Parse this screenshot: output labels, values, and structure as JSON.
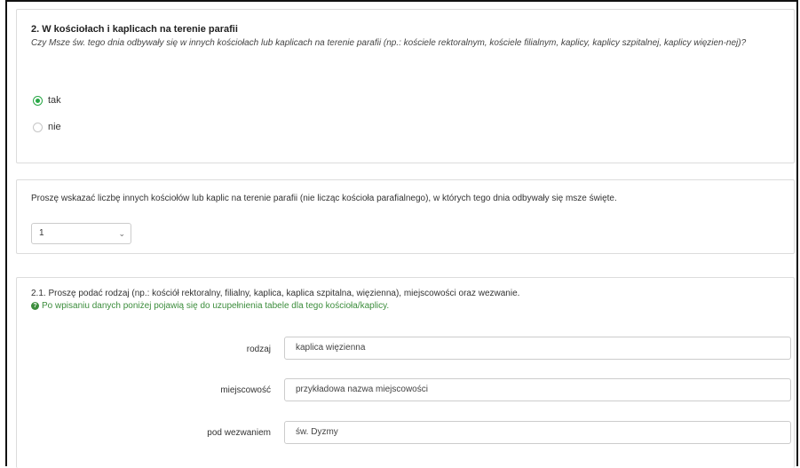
{
  "section1": {
    "title": "2. W kościołach i kaplicach na terenie parafii",
    "question": "Czy Msze św. tego dnia odbywały się w innych kościołach lub kaplicach na terenie parafii (np.: kościele rektoralnym, kościele filialnym, kaplicy, kaplicy szpitalnej, kaplicy więzien-nej)?",
    "options": [
      {
        "label": "tak",
        "checked": true
      },
      {
        "label": "nie",
        "checked": false
      }
    ]
  },
  "section2": {
    "text": "Proszę wskazać liczbę innych kościołów lub kaplic na terenie parafii (nie licząc kościoła parafialnego), w których tego dnia odbywały się msze święte.",
    "select_value": "1"
  },
  "section3": {
    "instruction": "2.1. Proszę podać rodzaj (np.: kościół rektoralny, filialny, kaplica, kaplica szpitalna, więzienna), miejscowości oraz wezwanie.",
    "hint": "Po wpisaniu danych poniżej pojawią się do uzupełnienia tabele dla tego kościoła/kaplicy.",
    "hint_icon": "question-circle-icon",
    "fields": [
      {
        "label": "rodzaj",
        "value": "kaplica więzienna"
      },
      {
        "label": "miejscowość",
        "value": "przykładowa nazwa miejscowości"
      },
      {
        "label": "pod wezwaniem",
        "value": "św. Dyzmy"
      }
    ]
  },
  "colors": {
    "accent": "#28a745",
    "hint": "#3c8d3c",
    "border": "#dcdcdc"
  }
}
